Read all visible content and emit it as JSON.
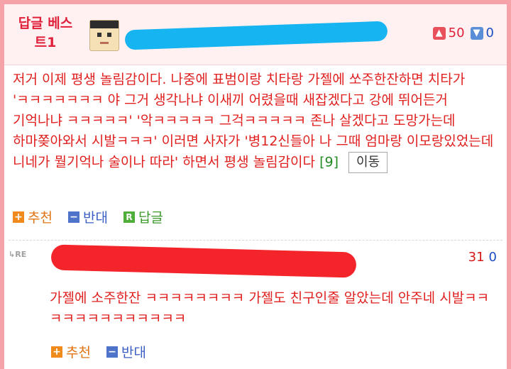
{
  "best_comment": {
    "badge": "답글 베스트1",
    "votes": {
      "up": "50",
      "down": "0",
      "up_icon": "thumbs-up-icon",
      "down_icon": "thumbs-down-icon"
    },
    "text": "저거 이제 평생 놀림감이다. 나중에 표범이랑 치타랑 가젤에 쏘주한잔하면 치타가 'ㅋㅋㅋㅋㅋㅋㅋ 야 그거 생각나냐 이새끼 어렸을때 새잡겠다고 강에 뛰어든거 기억나냐 ㅋㅋㅋㅋㅋ' '악ㅋㅋㅋㅋㅋ 그걱ㅋㅋㅋㅋㅋ 존나 살겠다고 도망가는데 하마쫒아와서 시발ㅋㅋㅋ' 이러면 사자가 '병12신들아 나 그때 엄마랑 이모랑있었는데 니네가 뭘기억나 술이나 따라' 하면서 평생 놀림감이다",
    "reply_count": "[9]",
    "move_label": "이동",
    "actions": {
      "recommend": "추천",
      "oppose": "반대",
      "reply": "답글"
    }
  },
  "reply": {
    "re_label": "RE",
    "votes": {
      "up": "31",
      "down": "0"
    },
    "text": "가젤에 소주한잔 ㅋㅋㅋㅋㅋㅋㅋㅋ 가젤도 친구인줄 알았는데 안주네 시발ㅋㅋㅋㅋㅋㅋㅋㅋㅋㅋㅋㅋㅋ",
    "actions": {
      "recommend": "추천",
      "oppose": "반대"
    }
  },
  "colors": {
    "border": "#f5a3a8",
    "header_bg": "#fff1f1",
    "text_red": "#e01f1f",
    "redact_blue": "#16b4f0",
    "redact_red": "#f4242b"
  }
}
